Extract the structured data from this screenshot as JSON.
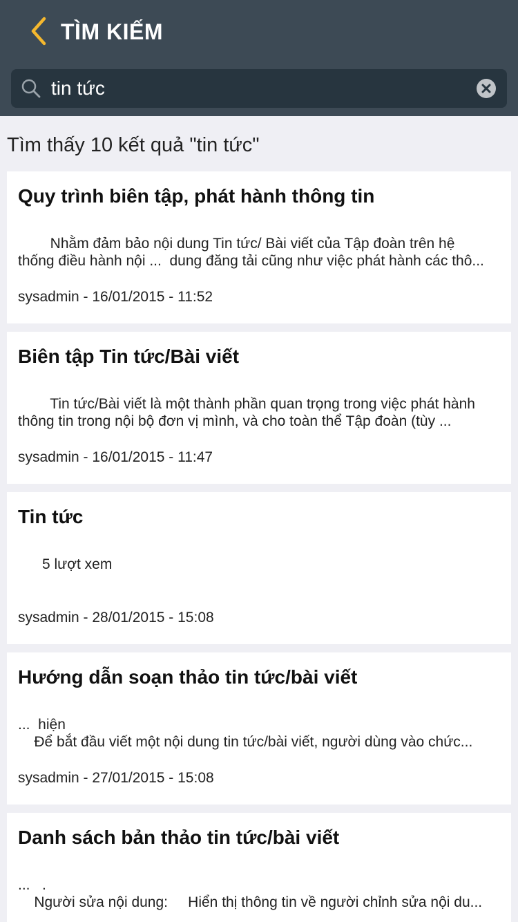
{
  "header": {
    "title": "TÌM KIẾM",
    "accent_color": "#f5b82e",
    "background": "#3d4a55"
  },
  "search": {
    "value": "tin tức",
    "icon": "search-icon",
    "clear_icon": "clear-icon"
  },
  "results": {
    "summary": "Tìm thấy 10 kết quả \"tin tức\"",
    "items": [
      {
        "title": "Quy trình biên tập, phát hành thông tin",
        "snippet_lines": [
          "        Nhằm đảm bảo nội dung Tin tức/ Bài viết của Tập đoàn trên hệ",
          "thống điều hành nội ...  dung đăng tải cũng như việc phát hành các thô..."
        ],
        "meta": "sysadmin - 16/01/2015 - 11:52"
      },
      {
        "title": "Biên tập Tin tức/Bài viết",
        "snippet_lines": [
          "        Tin tức/Bài viết là một thành phần quan trọng trong việc phát hành",
          "thông tin trong nội bộ đơn vị mình, và cho toàn thể Tập đoàn (tùy ..."
        ],
        "meta": "sysadmin - 16/01/2015 - 11:47"
      },
      {
        "title": "Tin tức",
        "snippet_lines": [
          "      5 lượt xem"
        ],
        "meta": "sysadmin - 28/01/2015 - 15:08"
      },
      {
        "title": "Hướng dẫn soạn thảo tin tức/bài viết",
        "snippet_lines": [
          "...  hiện",
          "    Để bắt đầu viết một nội dung tin tức/bài viết, người dùng vào chức..."
        ],
        "meta": "sysadmin - 27/01/2015 - 15:08"
      },
      {
        "title": "Danh sách bản thảo tin tức/bài viết",
        "snippet_lines": [
          "...   .",
          "    Người sửa nội dung:     Hiển thị thông tin về người chỉnh sửa nội du..."
        ],
        "meta": ""
      }
    ]
  }
}
